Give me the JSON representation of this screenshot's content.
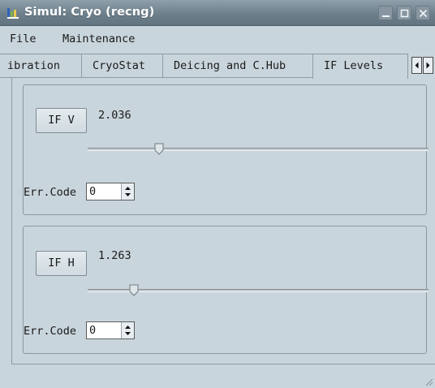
{
  "window": {
    "title": "Simul: Cryo (recng)",
    "buttons": [
      "minimize-icon",
      "maximize-icon",
      "close-icon"
    ]
  },
  "menubar": {
    "items": [
      "File",
      "Maintenance"
    ]
  },
  "tabs": {
    "items": [
      {
        "label": "Calibration",
        "visible_text": "ibration",
        "active": false
      },
      {
        "label": "CryoStat",
        "active": false
      },
      {
        "label": "Deicing and C.Hub",
        "active": false
      },
      {
        "label": "IF Levels",
        "active": true
      }
    ],
    "scroll_icons": [
      "arrow-left-icon",
      "arrow-right-icon"
    ]
  },
  "if_v": {
    "button_label": "IF V",
    "value": "2.036",
    "slider_fraction": 0.21,
    "err_label": "Err.Code",
    "err_value": "0"
  },
  "if_h": {
    "button_label": "IF H",
    "value": "1.263",
    "slider_fraction": 0.14,
    "err_label": "Err.Code",
    "err_value": "0"
  },
  "colors": {
    "background": "#c9d5dc",
    "titlebar": "#6d7f8b",
    "border": "#8d9ba4"
  }
}
